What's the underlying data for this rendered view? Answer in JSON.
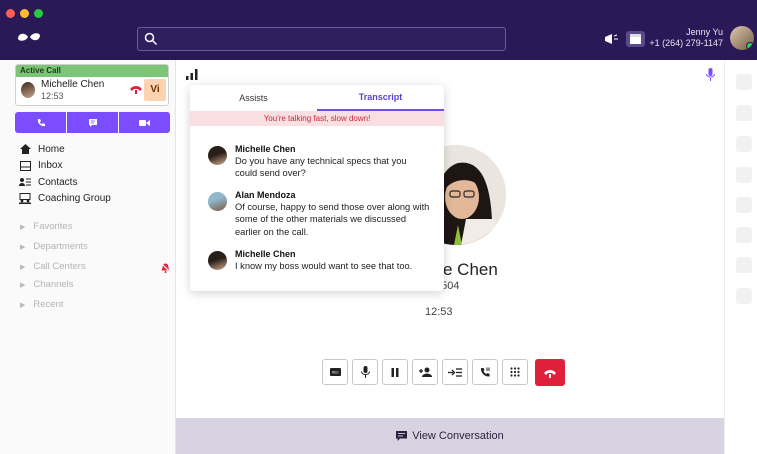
{
  "colors": {
    "topbar": "#2a1956",
    "accent": "#7b4dff",
    "active_call_header": "#7cc576",
    "end_call": "#e0203a",
    "warning_bg": "#f9dfe2",
    "warning_text": "#c8283a"
  },
  "topbar": {
    "search_placeholder": "",
    "user": {
      "name": "Jenny Yu",
      "phone": "+1 (264) 279-1147"
    }
  },
  "active_call": {
    "header": "Active Call",
    "contact_name": "Michelle Chen",
    "duration": "12:53",
    "badge": "Vi"
  },
  "call_actions": [
    "phone-icon",
    "message-icon",
    "video-icon"
  ],
  "nav": {
    "items": [
      {
        "label": "Home",
        "icon": "home-icon"
      },
      {
        "label": "Inbox",
        "icon": "inbox-icon"
      },
      {
        "label": "Contacts",
        "icon": "contacts-icon"
      },
      {
        "label": "Coaching Group",
        "icon": "coaching-icon"
      }
    ],
    "sections": [
      "Favorites",
      "Departments",
      "Call Centers",
      "Channels",
      "Recent"
    ]
  },
  "popup": {
    "tabs": [
      "Assists",
      "Transcript"
    ],
    "active_tab": "Transcript",
    "warning": "You're talking fast, slow down!",
    "messages": [
      {
        "speaker": "Michelle Chen",
        "text": "Do you have any technical specs that you could send over?"
      },
      {
        "speaker": "Alan Mendoza",
        "text": "Of course, happy to send those over along with some of the other materials we discussed earlier on the call."
      },
      {
        "speaker": "Michelle Chen",
        "text": "I know my boss would want to see that too."
      }
    ]
  },
  "call": {
    "caller_name_visible": "elle Chen",
    "caller_number_visible": "549-0504",
    "timer": "12:53"
  },
  "controls": [
    "record-icon",
    "mic-icon",
    "pause-icon",
    "add-participant-icon",
    "transfer-icon",
    "merge-icon",
    "keypad-icon",
    "hang-up-icon"
  ],
  "view_conversation": "View Conversation"
}
